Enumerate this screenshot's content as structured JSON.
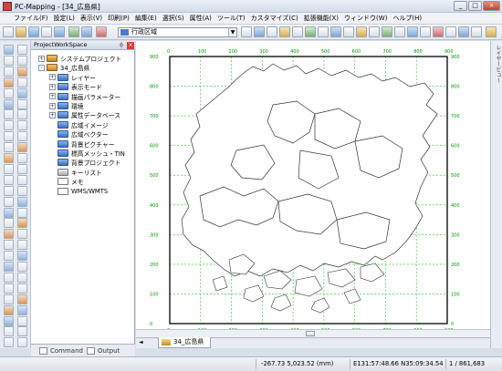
{
  "window": {
    "title": "PC-Mapping - [34_広島県]",
    "controls": [
      "_",
      "□",
      "×"
    ]
  },
  "menu": [
    "ファイル(F)",
    "設定(L)",
    "表示(V)",
    "印刷(P)",
    "編集(E)",
    "選択(S)",
    "属性(A)",
    "ツール(T)",
    "カスタマイズ(C)",
    "拡張機能(X)",
    "ウィンドウ(W)",
    "ヘルプ(H)"
  ],
  "toolbar": {
    "layer_combo": "行政区域",
    "combo_arrow": "▼"
  },
  "workspace": {
    "title": "ProjectWorkSpace",
    "pin": "ɸ",
    "close": "×",
    "tree": [
      {
        "label": "システムプロジェクト",
        "icon": "project-icon",
        "expander": "+"
      },
      {
        "label": "34_広島県",
        "icon": "project-icon",
        "expander": "-"
      },
      {
        "label": "レイヤー",
        "icon": "folder-icon",
        "expander": "+"
      },
      {
        "label": "表示モード",
        "icon": "folder-icon",
        "expander": "+"
      },
      {
        "label": "描画パラメーター",
        "icon": "folder-icon",
        "expander": "+"
      },
      {
        "label": "環境",
        "icon": "folder-icon",
        "expander": "+"
      },
      {
        "label": "属性データベース",
        "icon": "folder-icon",
        "expander": "+"
      },
      {
        "label": "広域イメージ",
        "icon": "folder-icon",
        "expander": ""
      },
      {
        "label": "広域ベクター",
        "icon": "folder-icon",
        "expander": ""
      },
      {
        "label": "背景ピクチャー",
        "icon": "folder-icon",
        "expander": ""
      },
      {
        "label": "標高メッシュ・TIN",
        "icon": "folder-icon",
        "expander": ""
      },
      {
        "label": "背景プロジェクト",
        "icon": "folder-icon",
        "expander": ""
      },
      {
        "label": "キーリスト",
        "icon": "keylist-icon",
        "expander": ""
      },
      {
        "label": "メモ",
        "icon": "memo-icon",
        "expander": ""
      },
      {
        "label": "WMS/WMTS",
        "icon": "wms-icon",
        "expander": ""
      }
    ],
    "tabs": [
      "Command",
      "Output"
    ]
  },
  "right_panel": {
    "label": "レイヤービュー"
  },
  "map": {
    "tab_label": "34_広島県",
    "tab_nav": "◄",
    "grid_labels_top": [
      "0",
      "100",
      "200",
      "300",
      "400",
      "500",
      "600",
      "700",
      "800",
      "900"
    ],
    "grid_labels_bottom": [
      "0",
      "100",
      "200",
      "300",
      "400",
      "500",
      "600",
      "700",
      "800",
      "900"
    ],
    "grid_labels_side": [
      "900",
      "800",
      "700",
      "600",
      "500",
      "400",
      "300",
      "200",
      "100",
      "0"
    ]
  },
  "status": {
    "coords": "-267.73 5,023.52 (mm)",
    "latlon": "E131:57:48.66 N35:09:34.54",
    "scale": "1 / 861,683"
  }
}
